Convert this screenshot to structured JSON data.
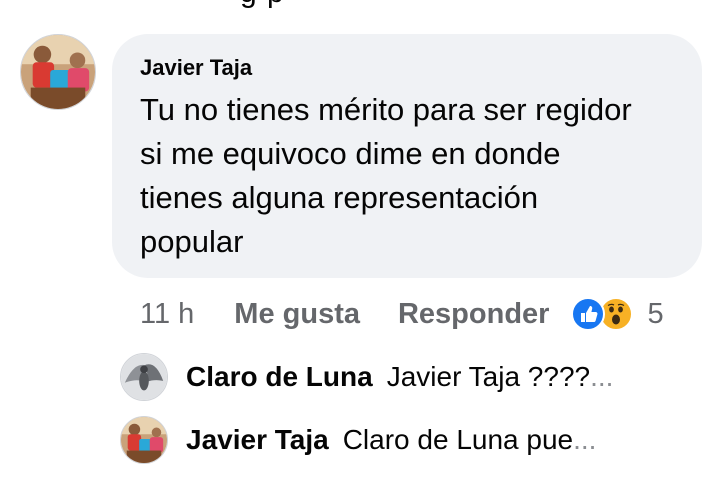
{
  "top_fragment": "g  p",
  "comment": {
    "author": "Javier Taja",
    "lines": [
      "Tu no tienes mérito para ser regidor",
      "si me equivoco  dime en donde",
      "tienes alguna representación",
      "popular"
    ],
    "time": "11 h",
    "like_label": "Me gusta",
    "reply_label": "Responder",
    "reaction_icons": [
      "like-icon",
      "wow-icon"
    ],
    "reaction_count": "5"
  },
  "replies": [
    {
      "author": "Claro de Luna",
      "preview": "Javier Taja ????",
      "ellipsis": "..."
    },
    {
      "author": "Javier Taja",
      "preview": "Claro de Luna pue",
      "ellipsis": "..."
    }
  ],
  "colors": {
    "bubble": "#f0f2f5",
    "secondary_text": "#65676b",
    "like_blue": "#1877f2",
    "wow_yellow": "#f7b125"
  }
}
